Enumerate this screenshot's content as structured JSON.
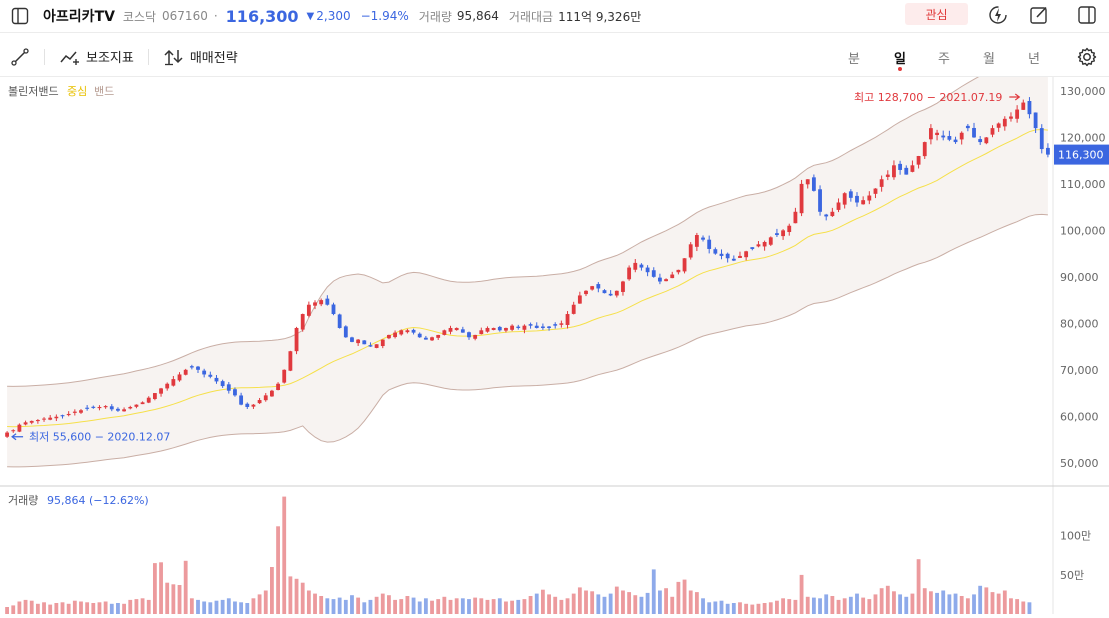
{
  "header": {
    "sidebar_toggle_icon": "sidebar-panel-icon",
    "stock_name": "아프리카TV",
    "market": "코스닥",
    "code": "067160",
    "dot": "·",
    "price": "116,300",
    "change_arrow": "▼",
    "change": "2,300",
    "change_pct": "−1.94%",
    "volume_label": "거래량",
    "volume": "95,864",
    "amount_label": "거래대금",
    "amount": "111억 9,326만",
    "favorite_label": "관심",
    "right_icons": [
      "flash-icon",
      "edit-icon",
      "split-panel-icon"
    ]
  },
  "toolbar": {
    "draw_icon": "line-draw-icon",
    "indicators_label": "보조지표",
    "strategy_label": "매매전략",
    "periods": [
      "분",
      "일",
      "주",
      "월",
      "년"
    ],
    "active_period": "일",
    "settings_icon": "gear-icon"
  },
  "colors": {
    "up": "#e0393e",
    "down": "#3b66e0",
    "band_fill": "#f7f3f1",
    "band_line": "#c9aea5",
    "center_line": "#f6e04a",
    "price_tag": "#3b66e0",
    "vol_up": "#ec9a9d",
    "vol_down": "#8eaaea"
  },
  "chart_data": {
    "type": "candlestick",
    "indicator_title": "볼린저밴드",
    "indicator_center": "중심",
    "indicator_band": "밴드",
    "y_ticks": [
      "130,000",
      "120,000",
      "110,000",
      "100,000",
      "90,000",
      "80,000",
      "70,000",
      "60,000",
      "50,000"
    ],
    "y_tick_values": [
      130000,
      120000,
      110000,
      100000,
      90000,
      80000,
      70000,
      60000,
      50000
    ],
    "ylim": [
      45000,
      133000
    ],
    "current_price": 116300,
    "current_price_label": "116,300",
    "high_annotation": "최고 128,700 − 2021.07.19",
    "high_value": 128700,
    "low_annotation": "최저 55,600 − 2020.12.07",
    "low_value": 55600,
    "closes": [
      56500,
      57000,
      58200,
      58700,
      59000,
      59200,
      59500,
      59700,
      59900,
      60000,
      60500,
      61000,
      61300,
      61600,
      61800,
      62000,
      62200,
      61500,
      61200,
      61500,
      62000,
      62500,
      63000,
      64000,
      65000,
      66000,
      67000,
      68000,
      69000,
      70000,
      70500,
      70000,
      69000,
      68500,
      67500,
      66500,
      65500,
      64500,
      62500,
      62000,
      62500,
      63500,
      64500,
      65500,
      67000,
      70000,
      74000,
      79000,
      82000,
      84000,
      84500,
      85000,
      84000,
      82000,
      79000,
      77000,
      76000,
      76500,
      75500,
      75000,
      75500,
      76500,
      77500,
      78000,
      78500,
      78500,
      78000,
      77000,
      76500,
      77000,
      77500,
      78500,
      79000,
      79000,
      78000,
      77000,
      77500,
      78500,
      79000,
      79000,
      78500,
      79000,
      79500,
      79000,
      79500,
      79500,
      79000,
      79000,
      79000,
      79500,
      80000,
      82000,
      84000,
      86000,
      87000,
      88000,
      87500,
      86500,
      86000,
      87000,
      89000,
      92000,
      93000,
      92000,
      91000,
      90000,
      89000,
      89500,
      90500,
      91500,
      94000,
      97000,
      99000,
      98000,
      96000,
      95000,
      94500,
      94000,
      93500,
      94500,
      95500,
      96000,
      97000,
      97500,
      98500,
      99000,
      100000,
      101000,
      104000,
      110000,
      111000,
      108500,
      104000,
      103000,
      104000,
      106000,
      108000,
      107000,
      106000,
      106500,
      107500,
      109000,
      111000,
      112000,
      114000,
      113000,
      112000,
      114000,
      116000,
      119000,
      122000,
      121000,
      120000,
      119500,
      119000,
      121000,
      122000,
      120000,
      119000,
      120000,
      122000,
      123000,
      124000,
      124500,
      126000,
      127500,
      125000,
      122000,
      117500,
      116300
    ],
    "volume_title": "거래량",
    "volume_value": "95,864 (−12.62%)",
    "volume_ticks": [
      "100만",
      "50만"
    ],
    "volume_tick_values": [
      1000000,
      500000
    ],
    "volumes": [
      90000,
      110000,
      160000,
      180000,
      170000,
      130000,
      150000,
      120000,
      140000,
      150000,
      130000,
      170000,
      160000,
      150000,
      140000,
      150000,
      160000,
      130000,
      140000,
      130000,
      180000,
      190000,
      200000,
      180000,
      650000,
      660000,
      400000,
      380000,
      370000,
      680000,
      200000,
      180000,
      160000,
      150000,
      170000,
      180000,
      200000,
      160000,
      150000,
      140000,
      200000,
      250000,
      300000,
      600000,
      1120000,
      1500000,
      480000,
      450000,
      400000,
      300000,
      260000,
      230000,
      200000,
      190000,
      210000,
      180000,
      240000,
      210000,
      150000,
      180000,
      220000,
      260000,
      240000,
      180000,
      190000,
      230000,
      210000,
      160000,
      200000,
      170000,
      190000,
      220000,
      180000,
      200000,
      200000,
      190000,
      210000,
      200000,
      180000,
      190000,
      200000,
      160000,
      170000,
      180000,
      190000,
      230000,
      260000,
      310000,
      250000,
      220000,
      180000,
      200000,
      260000,
      340000,
      300000,
      290000,
      250000,
      220000,
      260000,
      350000,
      300000,
      280000,
      240000,
      220000,
      270000,
      570000,
      300000,
      330000,
      220000,
      410000,
      440000,
      300000,
      280000,
      200000,
      150000,
      160000,
      170000,
      130000,
      140000,
      150000,
      130000,
      120000,
      130000,
      140000,
      150000,
      170000,
      200000,
      190000,
      180000,
      500000,
      220000,
      210000,
      200000,
      250000,
      230000,
      180000,
      200000,
      220000,
      260000,
      210000,
      190000,
      250000,
      330000,
      360000,
      290000,
      250000,
      220000,
      260000,
      700000,
      330000,
      290000,
      270000,
      300000,
      250000,
      260000,
      230000,
      200000,
      250000,
      360000,
      340000,
      280000,
      260000,
      300000,
      200000,
      190000,
      160000,
      150000
    ]
  }
}
